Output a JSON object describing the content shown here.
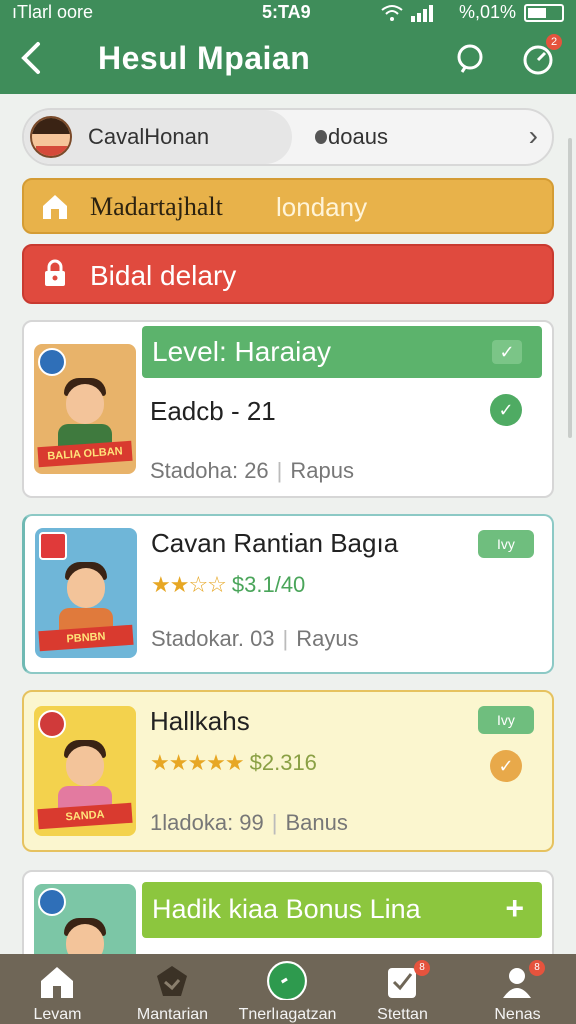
{
  "status_bar": {
    "carrier": "ıTlarl oore",
    "time": "5:TA9",
    "battery_text": "%,01%"
  },
  "app_bar": {
    "title": "Hesul Mpaian",
    "stats_badge": "2"
  },
  "profile": {
    "name": "CavalHonan",
    "bonus": "doaus"
  },
  "banners": {
    "yellow_a": "Madartajhalt",
    "yellow_b": "londany",
    "red": "Bidal delary"
  },
  "cards": [
    {
      "level_label": "Level: Haraiay",
      "title": "Eadcb - 21",
      "meta_a": "Stadoha: 26",
      "meta_b": "Rapus",
      "thumb_label": "BALIA OLBAN"
    },
    {
      "title": "Cavan Rantian Bagıa",
      "tag": "Ivy",
      "stars": "★★☆☆",
      "price": "$3.1/40",
      "meta_a": "Stadokar. 03",
      "meta_b": "Rayus",
      "thumb_label": "PBNBN"
    },
    {
      "title": "Hallkahs",
      "tag": "Ivy",
      "stars": "★★★★★",
      "price": "$2.316",
      "meta_a": "1ladoka: 99",
      "meta_b": "Banus",
      "thumb_label": "SANDA"
    },
    {
      "bonus_label": "Hadik kiaa Bonus Lina"
    }
  ],
  "bottom_nav": [
    {
      "label": "Levam"
    },
    {
      "label": "Mantarian"
    },
    {
      "label": "Tnerlıagatzan"
    },
    {
      "label": "Stettan",
      "badge": "8"
    },
    {
      "label": "Nenas",
      "badge": "8"
    }
  ],
  "colors": {
    "primary": "#3f8d5a",
    "banner_yellow": "#e8b24a",
    "banner_red": "#e04a3e",
    "level_green": "#5cb36c",
    "bonus_green": "#8cc63e",
    "nav_bg": "#6f6657"
  },
  "icons": {
    "back": "arrow-left",
    "search": "search",
    "stats": "speedometer",
    "home": "home",
    "lock": "padlock"
  }
}
